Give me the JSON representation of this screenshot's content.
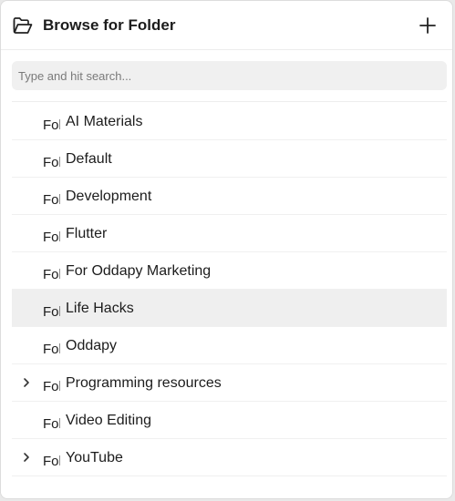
{
  "dialog": {
    "title": "Browse for Folder",
    "header_icon": "folder-open-icon",
    "add_icon": "plus-icon"
  },
  "search": {
    "placeholder": "Type and hit search...",
    "value": ""
  },
  "folders": [
    {
      "icon_text": "Folder",
      "label": "AI Materials",
      "expandable": false,
      "selected": false
    },
    {
      "icon_text": "Folder",
      "label": "Default",
      "expandable": false,
      "selected": false
    },
    {
      "icon_text": "Folder",
      "label": "Development",
      "expandable": false,
      "selected": false
    },
    {
      "icon_text": "Folder",
      "label": "Flutter",
      "expandable": false,
      "selected": false
    },
    {
      "icon_text": "Folder",
      "label": "For Oddapy Marketing",
      "expandable": false,
      "selected": false
    },
    {
      "icon_text": "Folder",
      "label": "Life Hacks",
      "expandable": false,
      "selected": true
    },
    {
      "icon_text": "Folder",
      "label": "Oddapy",
      "expandable": false,
      "selected": false
    },
    {
      "icon_text": "Folder",
      "label": "Programming resources",
      "expandable": true,
      "selected": false
    },
    {
      "icon_text": "Folder",
      "label": "Video Editing",
      "expandable": false,
      "selected": false
    },
    {
      "icon_text": "Folder",
      "label": "YouTube",
      "expandable": true,
      "selected": false
    }
  ]
}
